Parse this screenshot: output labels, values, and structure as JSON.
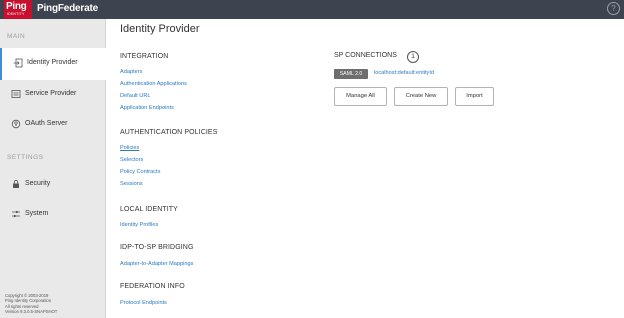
{
  "topbar": {
    "logo_main": "Ping",
    "logo_sub": "IDENTITY",
    "product_name": "PingFederate",
    "help_glyph": "?"
  },
  "sidebar": {
    "main_label": "MAIN",
    "settings_label": "SETTINGS",
    "items": [
      {
        "label": "Identity Provider",
        "icon": "identity-provider-icon"
      },
      {
        "label": "Service Provider",
        "icon": "service-provider-icon"
      },
      {
        "label": "OAuth Server",
        "icon": "oauth-icon"
      },
      {
        "label": "Security",
        "icon": "lock-icon"
      },
      {
        "label": "System",
        "icon": "sliders-icon"
      }
    ],
    "copyright": [
      "Copyright © 2003-2019",
      "Ping Identity Corporation",
      "All rights reserved",
      "Version 9.3.0.5-SNAPSHOT"
    ]
  },
  "main": {
    "title": "Identity Provider",
    "sections": [
      {
        "heading": "INTEGRATION",
        "links": [
          "Adapters",
          "Authentication Applications",
          "Default URL",
          "Application Endpoints"
        ]
      },
      {
        "heading": "AUTHENTICATION POLICIES",
        "links": [
          "Policies",
          "Selectors",
          "Policy Contracts",
          "Sessions"
        ]
      },
      {
        "heading": "LOCAL IDENTITY",
        "links": [
          "Identity Profiles"
        ]
      },
      {
        "heading": "IDP-TO-SP BRIDGING",
        "links": [
          "Adapter-to-Adapter Mappings"
        ]
      },
      {
        "heading": "FEDERATION INFO",
        "links": [
          "Protocol Endpoints"
        ]
      }
    ],
    "sp_connections": {
      "title": "SP CONNECTIONS",
      "count": "1",
      "protocol_badge": "SAML 2.0",
      "entity_id": "localhost:default:entityId",
      "buttons": [
        "Manage All",
        "Create New",
        "Import"
      ]
    }
  },
  "colors": {
    "topbar": "#3d4450",
    "brand_red": "#c8102e",
    "link": "#2a7ac6",
    "sidebar_bg": "#e9e9e9",
    "active_accent": "#3d8ee0"
  }
}
